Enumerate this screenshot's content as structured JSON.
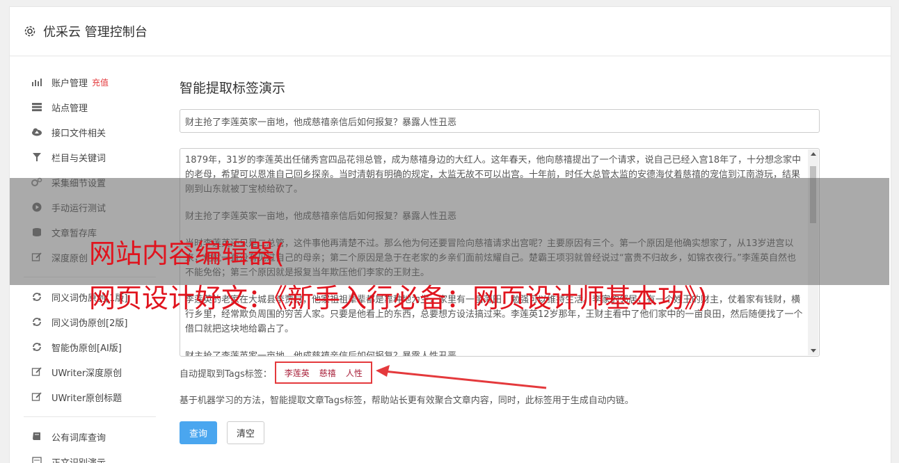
{
  "header": {
    "icon": "gear-icon",
    "title": "优采云 管理控制台"
  },
  "sidebar": {
    "group1": [
      {
        "icon": "bar-chart-icon",
        "label": "账户管理",
        "badge": "充值"
      },
      {
        "icon": "server-icon",
        "label": "站点管理"
      },
      {
        "icon": "cloud-upload-icon",
        "label": "接口文件相关"
      },
      {
        "icon": "filter-icon",
        "label": "栏目与关键词"
      },
      {
        "icon": "gears-icon",
        "label": "采集细节设置"
      },
      {
        "icon": "play-circle-icon",
        "label": "手动运行测试"
      },
      {
        "icon": "database-icon",
        "label": "文章暂存库"
      },
      {
        "icon": "edit-icon",
        "label": "深度原创"
      }
    ],
    "group2": [
      {
        "icon": "refresh-icon",
        "label": "同义词伪原创[1版]"
      },
      {
        "icon": "refresh-icon",
        "label": "同义词伪原创[2版]"
      },
      {
        "icon": "refresh-icon",
        "label": "智能伪原创[AI版]"
      },
      {
        "icon": "edit-icon",
        "label": "UWriter深度原创"
      },
      {
        "icon": "edit-icon",
        "label": "UWriter原创标题"
      }
    ],
    "group3": [
      {
        "icon": "book-icon",
        "label": "公有词库查询"
      },
      {
        "icon": "file-icon",
        "label": "正文识别演示"
      }
    ]
  },
  "main": {
    "page_title": "智能提取标签演示",
    "title_input_value": "财主抢了李莲英家一亩地，他成慈禧亲信后如何报复？暴露人性丑恶",
    "body_paragraphs": [
      "1879年，31岁的李莲英出任储秀宫四品花翎总管，成为慈禧身边的大红人。这年春天，他向慈禧提出了一个请求，说自己已经入宫18年了，十分想念家中的老母，希望可以恩准自己回乡探亲。当时清朝有明确的规定，太监无故不可以出宫。十年前，时任大总管太监的安德海仗着慈禧的宠信到江南游玩，结果刚到山东就被丁宝桢给砍了。",
      "财主抢了李莲英家一亩地，他成慈禧亲信后如何报复？暴露人性丑恶",
      "当时李莲英还只是二总管，这件事他再清楚不过。那么他为何还要冒险向慈禧请求出宫呢？主要原因有三个。第一个原因是他确实想家了，从13岁进宫以来，他就一直没有见过自己的母亲；第二个原因是急于在老家的乡亲们面前炫耀自己。楚霸王项羽就曾经说过“富贵不归故乡，如锦衣夜行。”李莲英自然也不能免俗；第三个原因就是报复当年欺压他们李家的王财主。",
      "李莲英的老家在大城县李贾村，他家祖祖辈辈都是靠种地为生，家里有一亩薄田，勉强可以维持生活。李家的邻居，有一个姓王的财主，仗着家有钱财，横行乡里，经常欺负周围的穷苦人家。只要是他看上的东西，总要想方设法搞过来。李莲英12岁那年，王财主看中了他们家中的一亩良田，然后随便找了一个借口就把这块地给霸占了。",
      "财主抢了李莲英家一亩地，他成慈禧亲信后如何报复？暴露人性丑恶"
    ],
    "tags_label": "自动提取到Tags标签：",
    "tags": [
      "李莲英",
      "慈禧",
      "人性"
    ],
    "description": "基于机器学习的方法，智能提取文章Tags标签，帮助站长更有效聚合文章内容，同时，此标签用于生成自动内链。",
    "query_button": "查询",
    "clear_button": "清空"
  },
  "overlay": {
    "line1": "网站内容编辑器(",
    "line2": "网页设计好文：《新手入行必备：网页设计师基本功》)"
  },
  "colors": {
    "accent": "#4aa6ef",
    "highlight": "#e4393c",
    "tag_text": "#a8203a"
  }
}
